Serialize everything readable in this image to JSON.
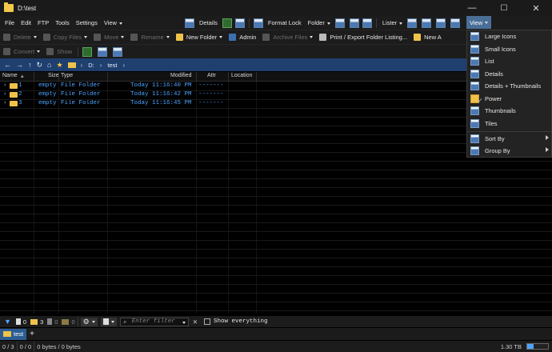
{
  "window": {
    "title": "D:\\test",
    "controls": [
      "—",
      "☐",
      "✕"
    ]
  },
  "menubar": {
    "items": [
      "File",
      "Edit",
      "FTP",
      "Tools",
      "Settings",
      "View"
    ],
    "details_label": "Details",
    "format_lock_label": "Format Lock",
    "folder_label": "Folder",
    "lister_label": "Lister",
    "view_label": "View"
  },
  "toolbar1": {
    "items": [
      "Delete",
      "Copy Files",
      "Move",
      "Rename",
      "New Folder",
      "Admin",
      "Archive Files",
      "Print / Export Folder Listing...",
      "New A"
    ]
  },
  "toolbar2": {
    "items": [
      "Convert",
      "Show"
    ]
  },
  "address": {
    "drive": "D:",
    "folder": "test"
  },
  "columns": [
    "Name",
    "Size",
    "Type",
    "Modified",
    "Attr",
    "Location"
  ],
  "files": [
    {
      "name": "1",
      "size": "empty",
      "type": "File Folder",
      "modified": "Today  11:16:40 PM",
      "attr": "-------"
    },
    {
      "name": "2",
      "size": "empty",
      "type": "File Folder",
      "modified": "Today  11:16:42 PM",
      "attr": "-------"
    },
    {
      "name": "3",
      "size": "empty",
      "type": "File Folder",
      "modified": "Today  11:16:45 PM",
      "attr": "-------"
    }
  ],
  "filterbar": {
    "file_count": "0",
    "folder_count": "3",
    "count3": "0",
    "count4": "0",
    "filter_placeholder": "Enter filter",
    "clear": "✕",
    "show_everything": "Show everything"
  },
  "tabs": {
    "active": "test",
    "add": "+"
  },
  "status": {
    "selected": "0 / 3",
    "files": "0 / 0",
    "bytes": "0 bytes / 0 bytes",
    "free": "1.30 TB"
  },
  "view_menu": {
    "items": [
      "Large Icons",
      "Small Icons",
      "List",
      "Details",
      "Details + Thumbnails",
      "Power",
      "Thumbnails",
      "Tiles"
    ],
    "sort_by": "Sort By",
    "group_by": "Group By",
    "checked": "Power"
  },
  "colors": {
    "accent": "#4a6f97",
    "address": "#1f3f6f",
    "file_text": "#4ea3ff",
    "folder": "#f0c24a"
  }
}
